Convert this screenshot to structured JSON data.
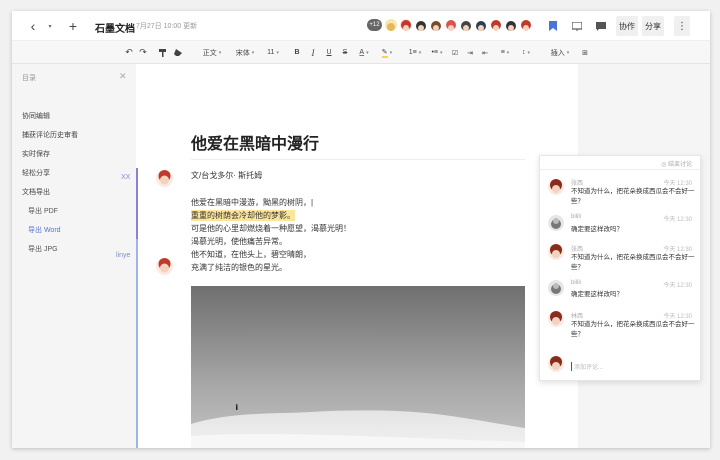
{
  "app": {
    "doc_title": "石墨文档",
    "updated": "7月27日 10:00 更新",
    "collab_count": "+12",
    "collab_btn": "协作",
    "share_btn": "分享",
    "more": "⋮",
    "back": "‹",
    "caret": "▾",
    "new": "+"
  },
  "toolbar": {
    "undo": "↶",
    "redo": "↷",
    "format_painter": "🖌",
    "clear": "⌫",
    "style": "正文",
    "font": "宋体",
    "size": "11",
    "bold": "B",
    "italic": "I",
    "underline": "U",
    "strike": "S",
    "color": "A",
    "highlight": "✎",
    "ol": "1≡",
    "ul": "•≡",
    "checklist": "☑",
    "indent_in": "⇥",
    "indent_out": "⇤",
    "align": "≡",
    "line_height": "↕",
    "insert": "插入",
    "more": "⊞"
  },
  "sidebar": {
    "header": "目录",
    "close": "✕",
    "items": [
      {
        "label": "协同编辑"
      },
      {
        "label": "捕获评论历史审看"
      },
      {
        "label": "实时保存"
      },
      {
        "label": "轻松分享"
      },
      {
        "label": "文档导出"
      },
      {
        "label": "导出 PDF"
      },
      {
        "label": "导出 Word"
      },
      {
        "label": "导出 JPG"
      }
    ]
  },
  "doc": {
    "title": "他爱在黑暗中漫行",
    "author": "文/台戈多尔· 斯托姆",
    "lines": [
      "他爱在黑暗中漫游，黝黑的树阴，|",
      "重重的树荫会冷却他的梦影。",
      "可是他的心里却燃烧着一种愿望，渴慕光明！",
      "渴慕光明，使他痛苦异常。",
      "他不知道，在他头上，碧空晴朗，",
      "充满了纯洁的银色的星光。"
    ],
    "mark_1": "XX",
    "mark_2": "linye"
  },
  "comments": {
    "header": "◎ 结束讨论",
    "placeholder": "添加评论...",
    "items": [
      {
        "name": "张西",
        "time": "今天 12:30",
        "text": "不知道为什么，把花朵换成西瓜会不会好一些？"
      },
      {
        "name": "bilili",
        "time": "今天 12:30",
        "text": "确定要这样改吗？"
      },
      {
        "name": "张西",
        "time": "今天 12:30",
        "text": "不知道为什么，把花朵换成西瓜会不会好一些？"
      },
      {
        "name": "bilili",
        "time": "今天 12:30",
        "text": "确定要这样改吗？"
      },
      {
        "name": "林西",
        "time": "今天 12:30",
        "text": "不知道为什么，把花朵换成西瓜会不会好一些？"
      }
    ]
  },
  "colors": {
    "accent": "#5b76c7",
    "highlight": "#fbe59a",
    "av_red": "#e0533d",
    "av_dark": "#3b3b3b"
  }
}
